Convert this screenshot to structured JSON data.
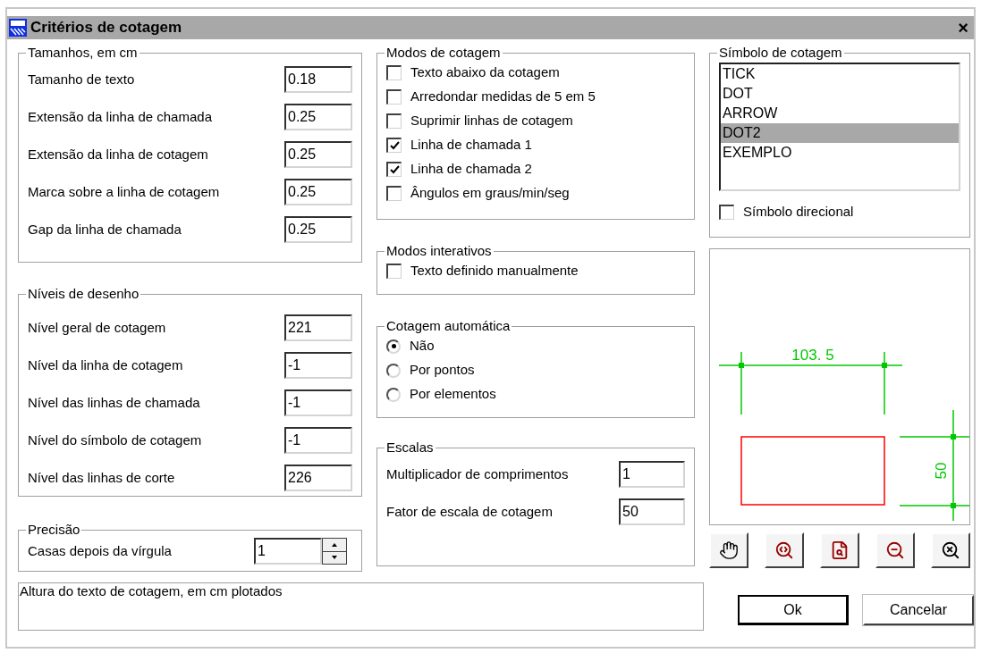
{
  "window": {
    "title": "Critérios de cotagem",
    "close": "×"
  },
  "sizes": {
    "title": "Tamanhos, em cm",
    "fields": [
      {
        "label": "Tamanho de texto",
        "value": "0.18"
      },
      {
        "label": "Extensão da linha de chamada",
        "value": "0.25"
      },
      {
        "label": "Extensão da linha de cotagem",
        "value": "0.25"
      },
      {
        "label": "Marca sobre a linha de cotagem",
        "value": "0.25"
      },
      {
        "label": "Gap da linha de chamada",
        "value": "0.25"
      }
    ]
  },
  "levels": {
    "title": "Níveis de desenho",
    "fields": [
      {
        "label": "Nível geral de cotagem",
        "value": "221"
      },
      {
        "label": "Nível da linha de cotagem",
        "value": "-1"
      },
      {
        "label": "Nível das linhas de chamada",
        "value": "-1"
      },
      {
        "label": "Nível do símbolo de cotagem",
        "value": "-1"
      },
      {
        "label": "Nível das linhas de corte",
        "value": "226"
      }
    ]
  },
  "precision": {
    "title": "Precisão",
    "label": "Casas depois da vírgula",
    "value": "1"
  },
  "modes": {
    "title": "Modos de cotagem",
    "options": [
      {
        "label": "Texto abaixo da cotagem",
        "checked": false
      },
      {
        "label": "Arredondar medidas de 5 em 5",
        "checked": false
      },
      {
        "label": "Suprimir linhas de cotagem",
        "checked": false
      },
      {
        "label": "Linha de chamada 1",
        "checked": true
      },
      {
        "label": "Linha de chamada 2",
        "checked": true
      },
      {
        "label": "Ângulos em graus/min/seg",
        "checked": false
      }
    ]
  },
  "interactive": {
    "title": "Modos interativos",
    "options": [
      {
        "label": "Texto definido manualmente",
        "checked": false
      }
    ]
  },
  "automatic": {
    "title": "Cotagem automática",
    "options": [
      {
        "label": "Não",
        "selected": true
      },
      {
        "label": "Por pontos",
        "selected": false
      },
      {
        "label": "Por elementos",
        "selected": false
      }
    ]
  },
  "scales": {
    "title": "Escalas",
    "fields": [
      {
        "label": "Multiplicador de comprimentos",
        "value": "1"
      },
      {
        "label": "Fator de escala de cotagem",
        "value": "50"
      }
    ]
  },
  "symbol": {
    "title": "Símbolo de cotagem",
    "items": [
      {
        "label": "TICK",
        "selected": false
      },
      {
        "label": "DOT",
        "selected": false
      },
      {
        "label": "ARROW",
        "selected": false
      },
      {
        "label": "DOT2",
        "selected": true
      },
      {
        "label": "EXEMPLO",
        "selected": false
      }
    ],
    "directional": {
      "label": "Símbolo direcional",
      "checked": false
    }
  },
  "preview": {
    "horizontal_dimension": "103. 5",
    "vertical_dimension": "50"
  },
  "status": "Altura do texto de cotagem, em cm plotados",
  "buttons": [
    {
      "label": "Ok",
      "default": true
    },
    {
      "label": "Cancelar",
      "default": false
    }
  ]
}
